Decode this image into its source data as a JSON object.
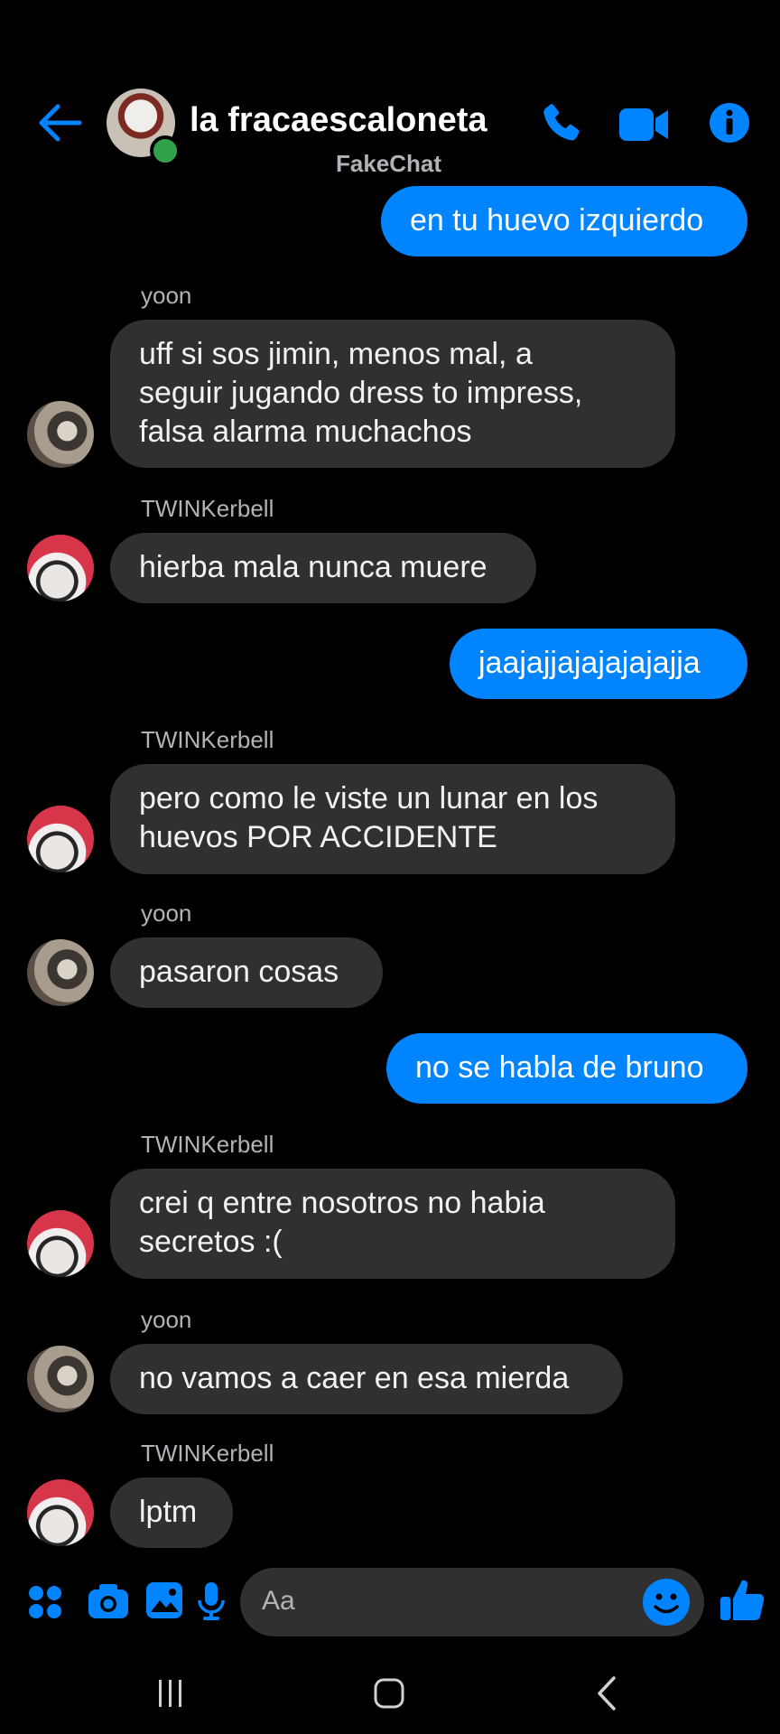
{
  "header": {
    "title": "la fracaescaloneta",
    "subtitle": "FakeChat",
    "accent_color": "#0084ff",
    "icons": [
      "back-arrow-icon",
      "phone-icon",
      "video-camera-icon",
      "info-icon"
    ]
  },
  "messages": [
    {
      "type": "outgoing",
      "text": "en tu huevo izquierdo"
    },
    {
      "type": "incoming",
      "sender": "yoon",
      "lines": [
        "uff si sos jimin, menos mal, a",
        "seguir jugando dress to impress,",
        "falsa alarma muchachos"
      ]
    },
    {
      "type": "incoming",
      "sender": "TWINKerbell",
      "lines": [
        "hierba mala nunca muere"
      ]
    },
    {
      "type": "outgoing",
      "text": "jaajajjajajajajajja"
    },
    {
      "type": "incoming",
      "sender": "TWINKerbell",
      "lines": [
        "pero como le viste un lunar en los",
        "huevos POR ACCIDENTE"
      ]
    },
    {
      "type": "incoming",
      "sender": "yoon",
      "lines": [
        "pasaron cosas"
      ]
    },
    {
      "type": "outgoing",
      "text": "no se habla de bruno"
    },
    {
      "type": "incoming",
      "sender": "TWINKerbell",
      "lines": [
        "crei q entre nosotros no habia",
        "secretos :("
      ]
    },
    {
      "type": "incoming",
      "sender": "yoon",
      "lines": [
        "no vamos a caer en esa mierda"
      ]
    },
    {
      "type": "incoming",
      "sender": "TWINKerbell",
      "lines": [
        "lptm"
      ]
    }
  ],
  "composer": {
    "placeholder": "Aa",
    "icons": [
      "apps-icon",
      "camera-icon",
      "gallery-icon",
      "microphone-icon",
      "emoji-icon",
      "thumbs-up-icon"
    ]
  },
  "navbar": {
    "icons": [
      "recent-apps-icon",
      "home-icon",
      "back-icon"
    ]
  }
}
